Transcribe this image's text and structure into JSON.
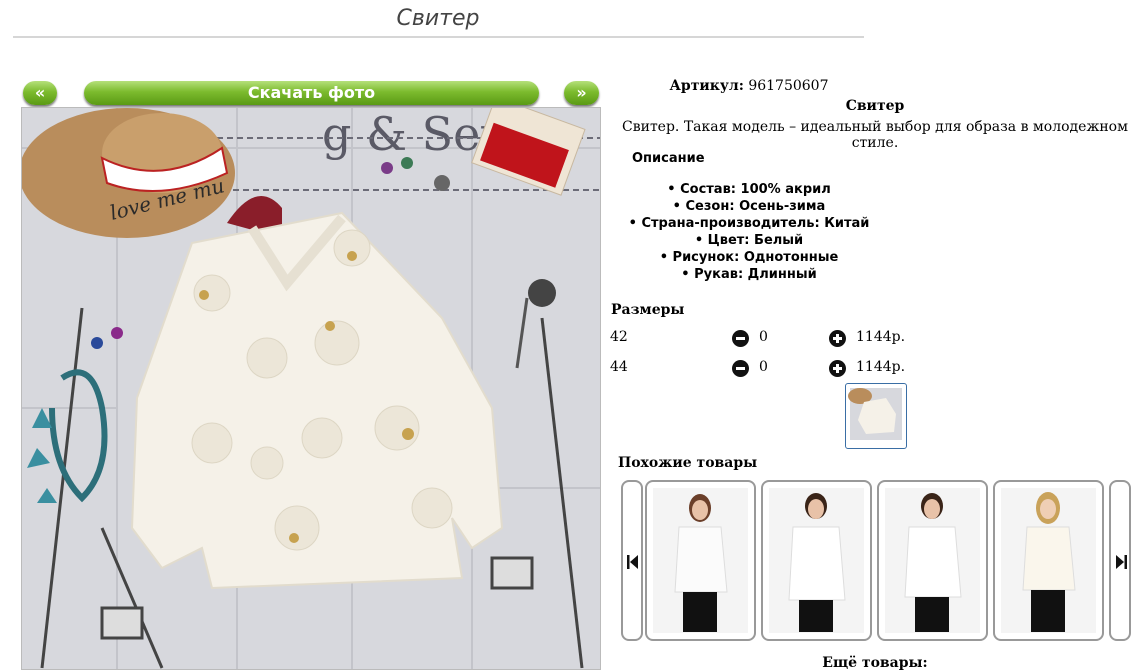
{
  "page": {
    "title": "Свитер"
  },
  "gallery": {
    "prev_label": "«",
    "download_label": "Скачать фото",
    "next_label": "»",
    "photo_text": "g & Sew",
    "hat_text": "love me mu"
  },
  "product": {
    "sku_label": "Артикул:",
    "sku_value": "961750607",
    "name": "Свитер",
    "summary": "Свитер. Такая модель – идеальный выбор для образа в молодежном стиле.",
    "description_heading": "Описание",
    "properties": [
      "Состав: 100% акрил",
      "Сезон: Осень-зима",
      "Страна-производитель: Китай",
      "Цвет: Белый",
      "Рисунок: Однотонные",
      "Рукав: Длинный"
    ]
  },
  "sizes": {
    "heading": "Размеры",
    "rows": [
      {
        "size": "42",
        "qty": "0",
        "price": "1144р."
      },
      {
        "size": "44",
        "qty": "0",
        "price": "1144р."
      }
    ]
  },
  "similar": {
    "heading": "Похожие товары",
    "items": [
      "white-sweater-1",
      "white-sweater-2",
      "white-sweater-3",
      "white-sweater-4"
    ]
  },
  "more": {
    "heading": "Ещё товары:"
  },
  "colors": {
    "accent_green": "#7cbb2e",
    "thumb_border": "#3a6ea5"
  }
}
